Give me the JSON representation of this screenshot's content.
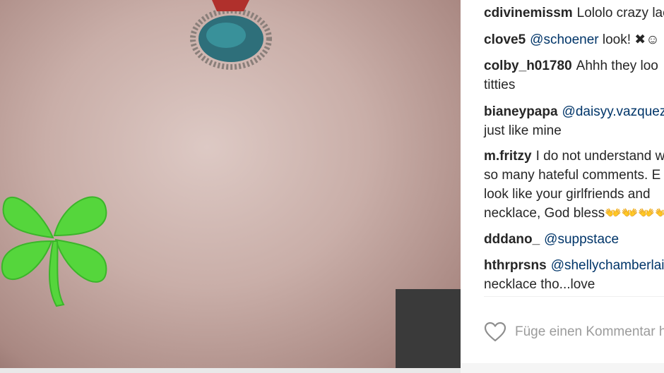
{
  "comments": [
    {
      "user": "cdivinemissm",
      "lines": [
        "Lololo crazy lac"
      ]
    },
    {
      "user": "clove5",
      "mention": "@schoener",
      "lines": [
        "look! ✖☺"
      ]
    },
    {
      "user": "colby_h01780",
      "lines": [
        "Ahhh they loo",
        "titties"
      ]
    },
    {
      "user": "bianeypapa",
      "mention": "@daisyy.vazquez",
      "lines": [
        "just like mine"
      ]
    },
    {
      "user": "m.fritzy",
      "lines": [
        "I do not understand w",
        "so many hateful comments. E",
        "look like your girlfriends and",
        "necklace, God bless👐👐👐👐"
      ]
    },
    {
      "user": "dddano_",
      "mention": "@suppstace",
      "lines": []
    },
    {
      "user": "hthrprsns",
      "mention": "@shellychamberlai",
      "lines": [
        "necklace tho...love"
      ]
    }
  ],
  "add_comment": {
    "placeholder": "Füge einen Kommentar h"
  }
}
